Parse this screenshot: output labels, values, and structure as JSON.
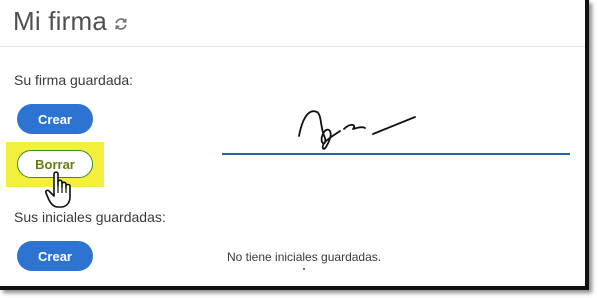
{
  "header": {
    "title": "Mi firma",
    "refresh_icon": "refresh-icon"
  },
  "signature": {
    "label": "Su firma guardada:",
    "create_label": "Crear",
    "delete_label": "Borrar"
  },
  "initials": {
    "label": "Sus iniciales guardadas:",
    "create_label": "Crear",
    "empty_message": "No tiene iniciales guardadas."
  },
  "colors": {
    "accent": "#2d73d2",
    "highlight": "#f3f03c",
    "signature_line": "#2a62a8"
  }
}
